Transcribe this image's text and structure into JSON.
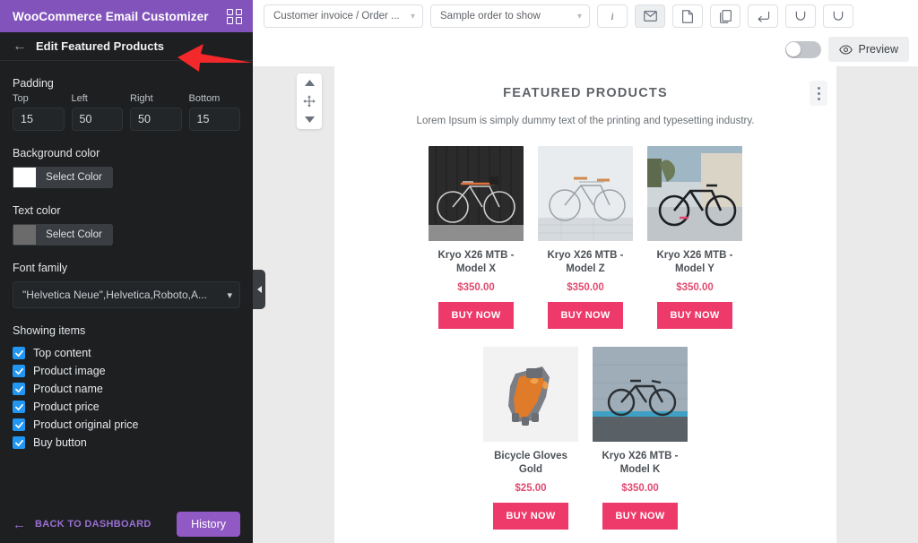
{
  "sidebar": {
    "brand_title": "WooCommerce Email Customizer",
    "grid_icon": "grid-icon",
    "panel_title": "Edit Featured Products",
    "back_icon": "arrow-left-icon",
    "padding": {
      "label": "Padding",
      "fields": [
        {
          "name": "top",
          "label": "Top",
          "value": "15"
        },
        {
          "name": "left",
          "label": "Left",
          "value": "50"
        },
        {
          "name": "right",
          "label": "Right",
          "value": "50"
        },
        {
          "name": "bottom",
          "label": "Bottom",
          "value": "15"
        }
      ]
    },
    "background_color": {
      "label": "Background color",
      "button_label": "Select Color",
      "swatch_hex": "#ffffff"
    },
    "text_color": {
      "label": "Text color",
      "button_label": "Select Color",
      "swatch_hex": "#6b6b6b"
    },
    "font_family": {
      "label": "Font family",
      "value": "\"Helvetica Neue\",Helvetica,Roboto,A...",
      "chevron_icon": "chevron-down-icon"
    },
    "showing_items": {
      "label": "Showing items",
      "items": [
        {
          "name": "top-content",
          "label": "Top content",
          "checked": true
        },
        {
          "name": "product-image",
          "label": "Product image",
          "checked": true
        },
        {
          "name": "product-name",
          "label": "Product name",
          "checked": true
        },
        {
          "name": "product-price",
          "label": "Product price",
          "checked": true
        },
        {
          "name": "product-original-price",
          "label": "Product original price",
          "checked": true
        },
        {
          "name": "buy-button",
          "label": "Buy button",
          "checked": true
        }
      ]
    },
    "footer": {
      "back_to_dashboard": "BACK TO DASHBOARD",
      "history_label": "History"
    },
    "collapse_handle_icon": "chevron-left-icon",
    "accent_purple": "#8254bb",
    "background_hex": "#1d1f21"
  },
  "topbar": {
    "email_type_select": {
      "value": "Customer invoice / Order ...",
      "chevron_icon": "chevron-down-icon"
    },
    "sample_order_select": {
      "value": "Sample order to show",
      "chevron_icon": "chevron-down-icon"
    },
    "buttons": [
      {
        "name": "info-button",
        "icon": "info-icon",
        "active": false
      },
      {
        "name": "send-mail-button",
        "icon": "envelope-icon",
        "active": true
      },
      {
        "name": "template-button",
        "icon": "document-icon",
        "active": false
      },
      {
        "name": "copy-button",
        "icon": "copy-icon",
        "active": false
      },
      {
        "name": "reset-button",
        "icon": "return-icon",
        "active": false
      },
      {
        "name": "undo-button",
        "icon": "undo-icon",
        "active": false
      },
      {
        "name": "redo-button",
        "icon": "redo-icon",
        "active": false
      }
    ],
    "preview_toggle": {
      "name": "responsive-toggle",
      "on": false
    },
    "preview_button": {
      "label": "Preview",
      "icon": "eye-icon"
    }
  },
  "email": {
    "gutter": {
      "move_up_icon": "caret-up-icon",
      "drag_icon": "move-icon",
      "move_down_icon": "caret-down-icon"
    },
    "kebab_icon": "more-vertical-icon",
    "section_title": "FEATURED PRODUCTS",
    "section_subtitle": "Lorem Ipsum is simply dummy text of the printing and typesetting industry.",
    "buy_label": "BUY NOW",
    "accent_pink": "#ee3a6a",
    "price_color": "#e24a6e",
    "rows": [
      [
        {
          "name": "Kryo X26 MTB - Model X",
          "price": "$350.00",
          "image": "bike-dark-wall"
        },
        {
          "name": "Kryo X26 MTB - Model Z",
          "price": "$350.00",
          "image": "bike-white-wall"
        },
        {
          "name": "Kryo X26 MTB - Model Y",
          "price": "$350.00",
          "image": "bike-street"
        }
      ],
      [
        {
          "name": "Bicycle Gloves Gold",
          "price": "$25.00",
          "image": "glove-orange"
        },
        {
          "name": "Kryo X26 MTB - Model K",
          "price": "$350.00",
          "image": "bike-blue-wall"
        }
      ]
    ]
  }
}
